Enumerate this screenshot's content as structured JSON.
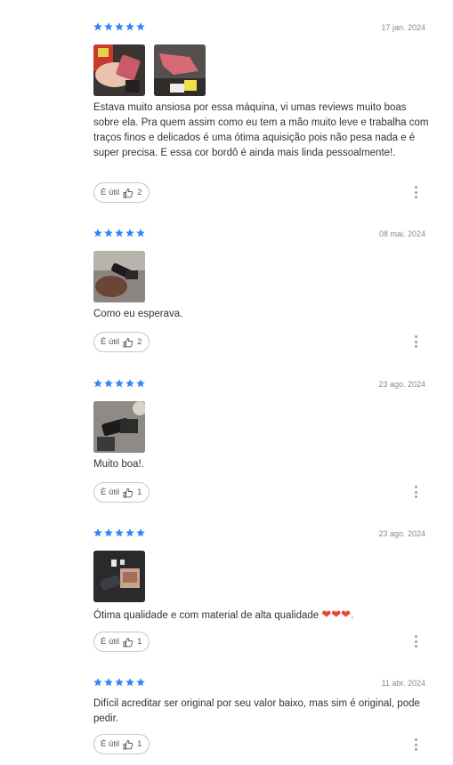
{
  "colors": {
    "star": "#3483fa",
    "text": "#333333",
    "date": "#8a8a8a",
    "heart": "#e8472e"
  },
  "reviews": [
    {
      "rating": 5,
      "date": "17 jan. 2024",
      "text": "Estava muito ansiosa por essa máquina, vi umas reviews muito boas sobre ela. Pra quem assim como eu tem a mão muito leve e trabalha com traços finos e delicados é uma ótima aquisição pois não pesa nada e é super precisa. E essa cor bordô é ainda mais linda pessoalmente!.",
      "helpful_label": "É útil",
      "helpful_count": "2",
      "photos": [
        "hand-holding-machine-photo",
        "machine-on-table-photo"
      ]
    },
    {
      "rating": 5,
      "date": "08 mai. 2024",
      "text": "Como eu esperava.",
      "helpful_label": "É útil",
      "helpful_count": "2",
      "photos": [
        "machine-in-hand-photo"
      ]
    },
    {
      "rating": 5,
      "date": "23 ago. 2024",
      "text": "Muito boa!.",
      "helpful_label": "É útil",
      "helpful_count": "1",
      "photos": [
        "machine-on-desk-photo"
      ]
    },
    {
      "rating": 5,
      "date": "23 ago. 2024",
      "text": "Ótima qualidade e com material de alta qualidade",
      "text_suffix": "❤❤❤.",
      "helpful_label": "É útil",
      "helpful_count": "1",
      "photos": [
        "machine-with-box-photo"
      ]
    },
    {
      "rating": 5,
      "date": "11 abr. 2024",
      "text": "Difícil acreditar ser original por seu valor baixo, mas sim é original, pode pedir.",
      "helpful_label": "É útil",
      "helpful_count": "1",
      "photos": []
    }
  ]
}
